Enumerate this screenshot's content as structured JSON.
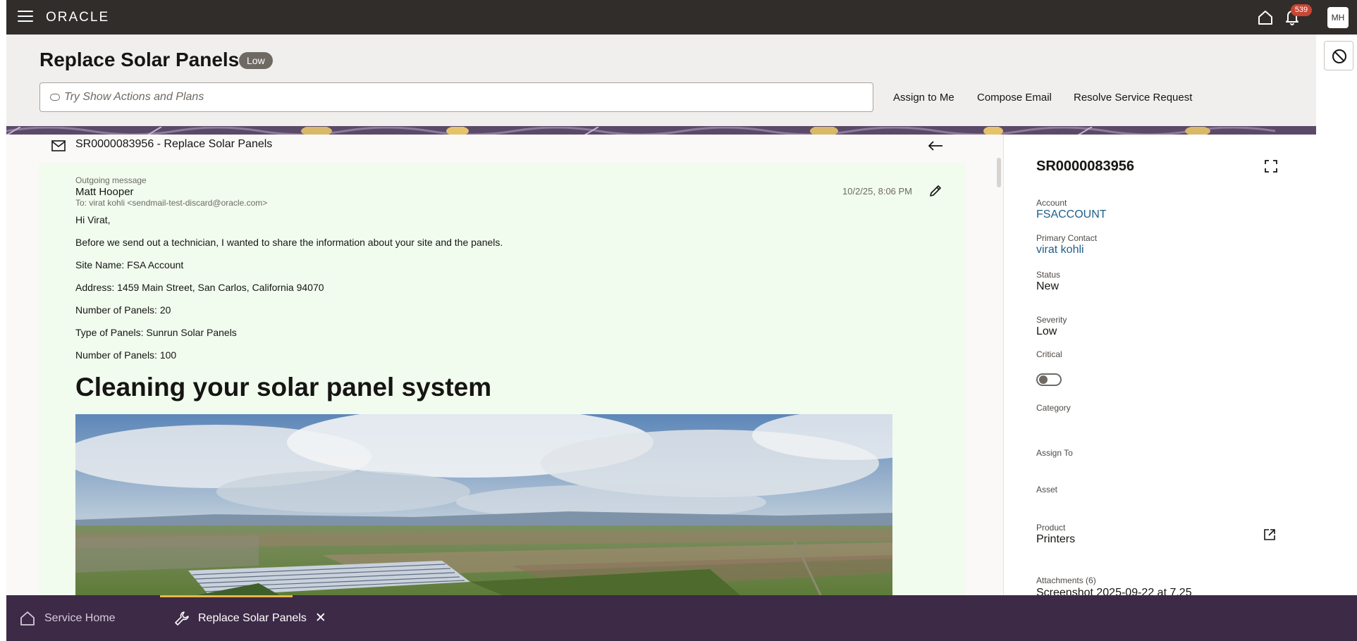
{
  "app": {
    "logo_text": "ORACLE",
    "notification_count": "539",
    "user_initials": "MH"
  },
  "header": {
    "title": "Replace Solar Panels",
    "severity_badge": "Low",
    "search_placeholder": "Try Show Actions and Plans",
    "actions": [
      "Assign to Me",
      "Compose Email",
      "Resolve Service Request"
    ]
  },
  "thread": {
    "title": "SR0000083956 - Replace Solar Panels"
  },
  "message": {
    "type_label": "Outgoing message",
    "sender": "Matt Hooper",
    "to": "To: virat kohli <sendmail-test-discard@oracle.com>",
    "timestamp": "10/2/25, 8:06 PM",
    "greeting": "Hi Virat,",
    "intro": "Before we send out a technician, I wanted to share the information about your site and the panels.",
    "site_name": "Site Name: FSA Account",
    "address": "Address:  1459 Main Street, San Carlos, California 94070",
    "panels_count": "Number of Panels: 20",
    "panel_type": "Type of Panels: Sunrun Solar Panels",
    "panels_count_2": "Number of Panels:  100",
    "heading": "Cleaning your solar panel system"
  },
  "details": {
    "sr_number": "SR0000083956",
    "account_label": "Account",
    "account_value": "FSACCOUNT",
    "primary_contact_label": "Primary Contact",
    "primary_contact_value": "virat kohli",
    "status_label": "Status",
    "status_value": "New",
    "severity_label": "Severity",
    "severity_value": "Low",
    "critical_label": "Critical",
    "critical_on": false,
    "category_label": "Category",
    "assign_to_label": "Assign To",
    "asset_label": "Asset",
    "product_label": "Product",
    "product_value": "Printers",
    "attachments_label": "Attachments (6)",
    "attachment_preview": "Screenshot 2025-09-22 at 7.25"
  },
  "bottom_tabs": [
    {
      "label": "Service Home",
      "icon": "home-icon",
      "active": false
    },
    {
      "label": "Replace Solar Panels",
      "icon": "wrench-icon",
      "active": true
    }
  ],
  "colors": {
    "topbar": "#312d2a",
    "bottombar": "#3d2a47",
    "link": "#1d5f8a",
    "badge": "#c74634",
    "message_bg": "#f1fcee"
  }
}
